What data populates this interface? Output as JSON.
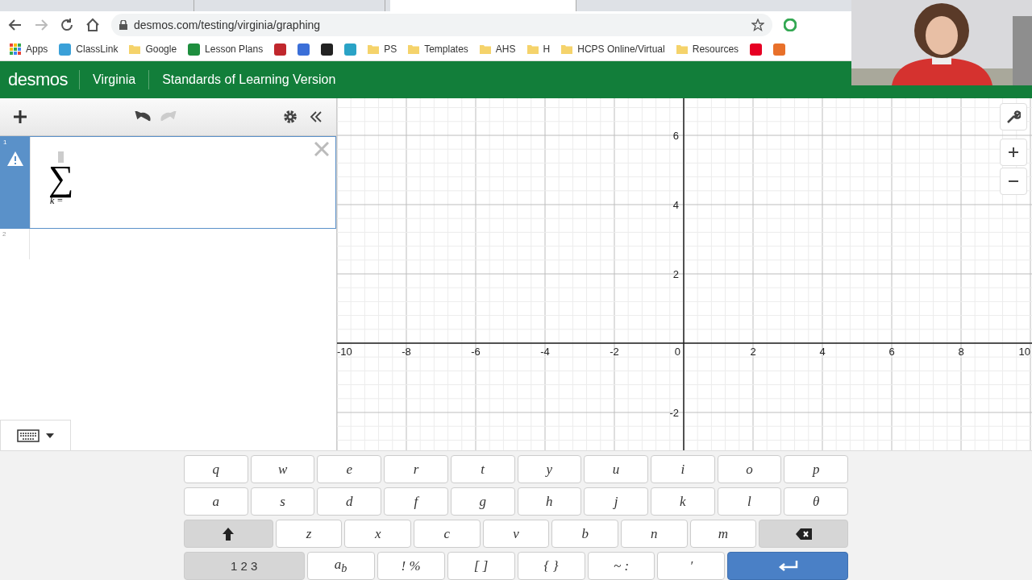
{
  "browser": {
    "tabs": [
      {
        "selected": false
      },
      {
        "selected": false
      },
      {
        "selected": true
      }
    ],
    "address": "desmos.com/testing/virginia/graphing",
    "bookmarks": [
      {
        "label": "Apps",
        "kind": "apps"
      },
      {
        "label": "ClassLink",
        "kind": "site",
        "color": "#3aa0d8"
      },
      {
        "label": "Google",
        "kind": "folder"
      },
      {
        "label": "Lesson Plans",
        "kind": "site",
        "color": "#1e8e3e"
      },
      {
        "kind": "site",
        "color": "#c0272d"
      },
      {
        "kind": "site",
        "color": "#3b6fd8"
      },
      {
        "kind": "site",
        "color": "#222222"
      },
      {
        "kind": "site",
        "color": "#2aa3c6"
      },
      {
        "label": "PS",
        "kind": "folder"
      },
      {
        "label": "Templates",
        "kind": "folder"
      },
      {
        "label": "AHS",
        "kind": "folder"
      },
      {
        "label": "H",
        "kind": "folder"
      },
      {
        "label": "HCPS Online/Virtual",
        "kind": "folder"
      },
      {
        "label": "Resources",
        "kind": "folder"
      },
      {
        "kind": "site",
        "color": "#e60023"
      },
      {
        "kind": "site",
        "color": "#e8702a"
      }
    ]
  },
  "header": {
    "logo": "desmos",
    "region": "Virginia",
    "version": "Standards of Learning Version"
  },
  "expressions": [
    {
      "number": "1",
      "selected": true,
      "warning": true,
      "symbol": "∑",
      "lower": "k ="
    },
    {
      "number": "2",
      "selected": false,
      "warning": false
    }
  ],
  "graph": {
    "x_ticks": [
      "-10",
      "-8",
      "-6",
      "-4",
      "-2",
      "0",
      "2",
      "4",
      "6",
      "8",
      "10"
    ],
    "y_ticks": [
      "6",
      "4",
      "2",
      "-2"
    ]
  },
  "keyboard": {
    "open": true
  },
  "keypad": [
    [
      {
        "kind": "key",
        "label": "q"
      },
      {
        "kind": "key",
        "label": "w"
      },
      {
        "kind": "key",
        "label": "e"
      },
      {
        "kind": "key",
        "label": "r"
      },
      {
        "kind": "key",
        "label": "t"
      },
      {
        "kind": "key",
        "label": "y"
      },
      {
        "kind": "key",
        "label": "u"
      },
      {
        "kind": "key",
        "label": "i"
      },
      {
        "kind": "key",
        "label": "o"
      },
      {
        "kind": "key",
        "label": "p"
      }
    ],
    [
      {
        "kind": "key",
        "label": "a"
      },
      {
        "kind": "key",
        "label": "s"
      },
      {
        "kind": "key",
        "label": "d"
      },
      {
        "kind": "key",
        "label": "f"
      },
      {
        "kind": "key",
        "label": "g"
      },
      {
        "kind": "key",
        "label": "h"
      },
      {
        "kind": "key",
        "label": "j"
      },
      {
        "kind": "key",
        "label": "k"
      },
      {
        "kind": "key",
        "label": "l"
      },
      {
        "kind": "key",
        "label": "θ"
      }
    ],
    [
      {
        "kind": "shift"
      },
      {
        "kind": "key",
        "label": "z"
      },
      {
        "kind": "key",
        "label": "x"
      },
      {
        "kind": "key",
        "label": "c"
      },
      {
        "kind": "key",
        "label": "v"
      },
      {
        "kind": "key",
        "label": "b"
      },
      {
        "kind": "key",
        "label": "n"
      },
      {
        "kind": "key",
        "label": "m"
      },
      {
        "kind": "backspace"
      }
    ],
    [
      {
        "kind": "mode",
        "label": "1 2 3"
      },
      {
        "kind": "key",
        "label": "a$_{b}$"
      },
      {
        "kind": "key",
        "label": "! %"
      },
      {
        "kind": "key",
        "label": "[ ]"
      },
      {
        "kind": "key",
        "label": "{ }"
      },
      {
        "kind": "key",
        "label": "~ :"
      },
      {
        "kind": "key",
        "label": "′"
      },
      {
        "kind": "enter"
      }
    ]
  ]
}
